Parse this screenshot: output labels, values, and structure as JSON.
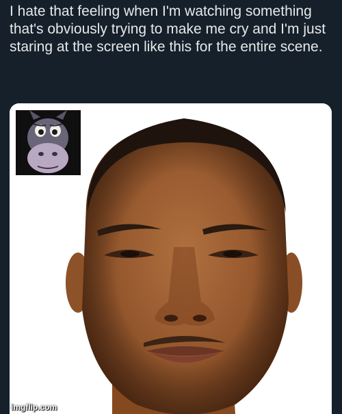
{
  "tweet": {
    "text": "I hate that feeling when I'm watching something that's obviously trying to make me cry and I'm just staring at the screen like this for the entire scene."
  },
  "media": {
    "main_image": "man-deadpan-face-photo",
    "inset_image": "donkey-face-thumbnail",
    "background_color": "#ffffff"
  },
  "watermark": {
    "text": "imgflip.com"
  },
  "colors": {
    "page_background": "#15202b",
    "text": "#e7e9ea"
  }
}
